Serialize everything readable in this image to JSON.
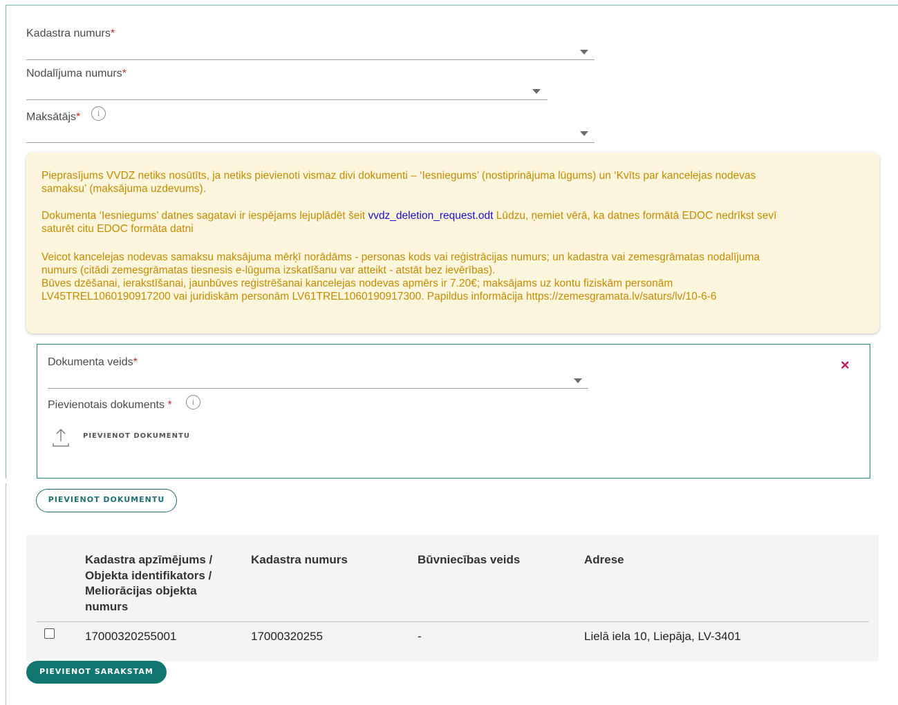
{
  "form": {
    "cadastre_number": {
      "label": "Kadastra numurs",
      "required": "*",
      "value": ""
    },
    "section_number": {
      "label": "Nodalījuma numurs",
      "required": "*",
      "value": ""
    },
    "payer": {
      "label": "Maksātājs",
      "required": "*",
      "value": ""
    }
  },
  "notice": {
    "p1": "Pieprasījums VVDZ netiks nosūtīts, ja netiks pievienoti vismaz divi dokumenti – ‘Iesniegums’ (nostiprinājuma lūgums) un ‘Kvīts par kancelejas nodevas samaksu’ (maksājuma uzdevums).",
    "p2_before": "Dokumenta ‘Iesniegums’ datnes sagatavi ir iespējams lejuplādēt šeit ",
    "p2_link": "vvdz_deletion_request.odt",
    "p2_after": " Lūdzu, ņemiet vērā, ka datnes formātā EDOC nedrīkst sevī saturēt citu EDOC formāta datni",
    "p3": "Veicot kancelejas nodevas samaksu maksājuma mērķī norādāms - personas kods vai reģistrācijas numurs; un kadastra vai zemesgrāmatas nodalījuma numurs (citādi zemesgrāmatas tiesnesis e-lūguma izskatīšanu var atteikt - atstāt bez ievērības).",
    "p4": "Būves dzēšanai, ierakstīšanai, jaunbūves reģistrēšanai kancelejas nodevas apmērs ir 7.20€; maksājams uz kontu fiziskām personām LV45TREL1060190917200 vai juridiskām personām LV61TREL1060190917300. Papildus informācija https://zemesgramata.lv/saturs/lv/10-6-6"
  },
  "document": {
    "type_label": "Dokumenta veids",
    "type_required": "*",
    "type_value": "",
    "attached_label": "Pievienotais dokuments ",
    "attached_required": "*",
    "upload_label": "PIEVIENOT DOKUMENTU",
    "remove_icon": "×"
  },
  "buttons": {
    "add_document": "PIEVIENOT DOKUMENTU",
    "add_to_list": "PIEVIENOT SARAKSTAM"
  },
  "table": {
    "headers": [
      "Kadastra apzīmējums / Objekta identifikators / Meliorācijas objekta numurs",
      "Kadastra numurs",
      "Būvniecības veids",
      "Adrese"
    ],
    "rows": [
      {
        "checked": false,
        "designation": "17000320255001",
        "cadastre_number": "17000320255",
        "construction_type": "-",
        "address": "Lielā iela 10, Liepāja, LV-3401"
      }
    ]
  },
  "colors": {
    "accent": "#11766f",
    "notice_bg": "#fdf6dc",
    "notice_text": "#c58b00",
    "required": "#c62828",
    "remove": "#c2185b"
  },
  "icons": {
    "info": "info-icon",
    "dropdown": "chevron-down-icon",
    "upload": "upload-icon",
    "remove": "close-icon"
  }
}
